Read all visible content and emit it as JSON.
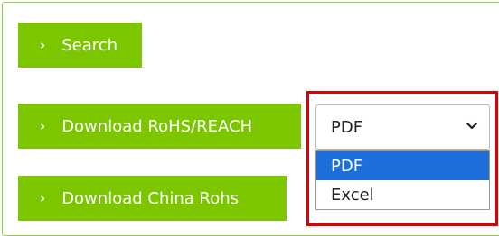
{
  "buttons": {
    "search": "Search",
    "download_rohs_reach": "Download RoHS/REACH",
    "download_china_rohs": "Download China Rohs"
  },
  "chevron": "›",
  "format_select": {
    "selected": "PDF",
    "options": [
      "PDF",
      "Excel"
    ],
    "highlighted_index": 0
  },
  "colors": {
    "button_green": "#7cc600",
    "highlight_border": "#e00000",
    "option_selected_bg": "#1e6fd9"
  },
  "icons": {
    "chevron": "chevron-right-icon",
    "caret": "chevron-down-icon"
  }
}
